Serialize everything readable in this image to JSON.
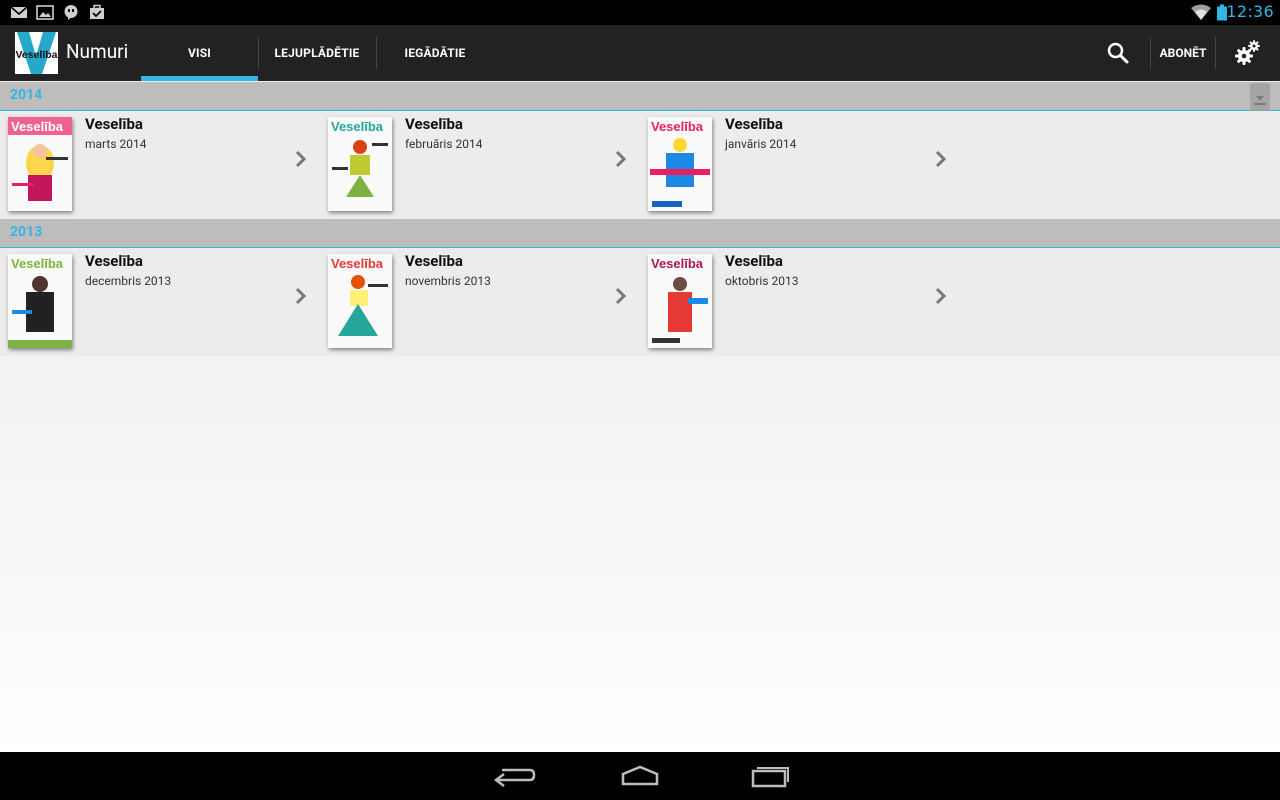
{
  "status_bar": {
    "time": "12:36",
    "left_icons": [
      "gmail-icon",
      "gallery-icon",
      "chat-icon",
      "briefcase-icon"
    ],
    "right_icons": [
      "wifi-icon",
      "battery-icon"
    ],
    "accent": "#33b5e5"
  },
  "action_bar": {
    "title": "Numuri",
    "logo_text": "Veselība",
    "tabs": [
      {
        "label": "VISI",
        "selected": true
      },
      {
        "label": "LEJUPLĀDĒTIE",
        "selected": false
      },
      {
        "label": "IEGĀDĀTIE",
        "selected": false
      }
    ],
    "subscribe_label": "ABONĒT",
    "actions": [
      "search-icon",
      "settings-icon"
    ]
  },
  "sections": [
    {
      "year": "2014",
      "issues": [
        {
          "title": "Veselība",
          "date": "marts 2014",
          "cover_color": "#c2185b"
        },
        {
          "title": "Veselība",
          "date": "februāris 2014",
          "cover_color": "#7cb342"
        },
        {
          "title": "Veselība",
          "date": "janvāris 2014",
          "cover_color": "#1e88e5"
        }
      ]
    },
    {
      "year": "2013",
      "issues": [
        {
          "title": "Veselība",
          "date": "decembris 2013",
          "cover_color": "#212121"
        },
        {
          "title": "Veselība",
          "date": "novembris 2013",
          "cover_color": "#26a69a"
        },
        {
          "title": "Veselība",
          "date": "oktobris 2013",
          "cover_color": "#e53935"
        }
      ]
    }
  ],
  "nav_bar": [
    "back-icon",
    "home-icon",
    "recent-apps-icon"
  ],
  "colors": {
    "accent": "#33b5e5",
    "action_bar_bg": "#222222",
    "section_header_bg": "#bdbdbd"
  }
}
